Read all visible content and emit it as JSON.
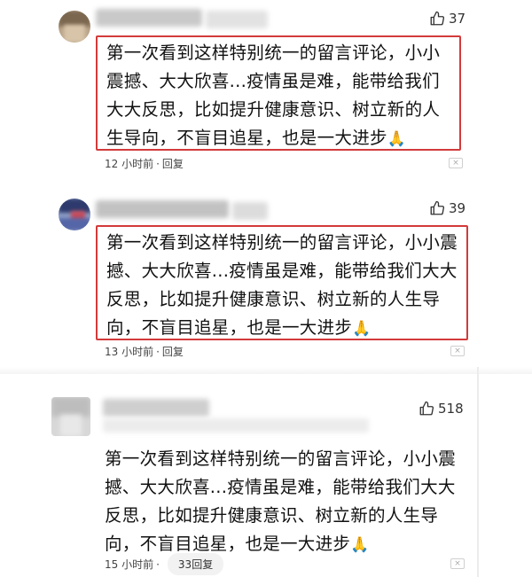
{
  "comments": [
    {
      "likes": "37",
      "text": "第一次看到这样特别统一的留言评论，小小震撼、大大欣喜...疫情虽是难，能带给我们大大反思，比如提升健康意识、树立新的人生导向，不盲目追星，也是一大进步",
      "emoji": "🙏",
      "time": "12 小时前",
      "separator": "·",
      "reply_label": "回复",
      "close_icon": "×"
    },
    {
      "likes": "39",
      "text": "第一次看到这样特别统一的留言评论，小小震撼、大大欣喜...疫情虽是难，能带给我们大大反思，比如提升健康意识、树立新的人生导向，不盲目追星，也是一大进步",
      "emoji": "🙏",
      "time": "13 小时前",
      "separator": "·",
      "reply_label": "回复",
      "close_icon": "×"
    },
    {
      "likes": "518",
      "text": "第一次看到这样特别统一的留言评论，小小震撼、大大欣喜...疫情虽是难，能带给我们大大反思，比如提升健康意识、树立新的人生导向，不盲目追星，也是一大进步",
      "emoji": "🙏",
      "time": "15 小时前",
      "separator": "·",
      "reply_label": "33回复",
      "close_icon": "×"
    }
  ],
  "colors": {
    "highlight_border": "#d33a3a",
    "text": "#111111",
    "meta": "#444444"
  },
  "icons": {
    "like": "thumbs-up-icon",
    "close": "close-icon"
  }
}
